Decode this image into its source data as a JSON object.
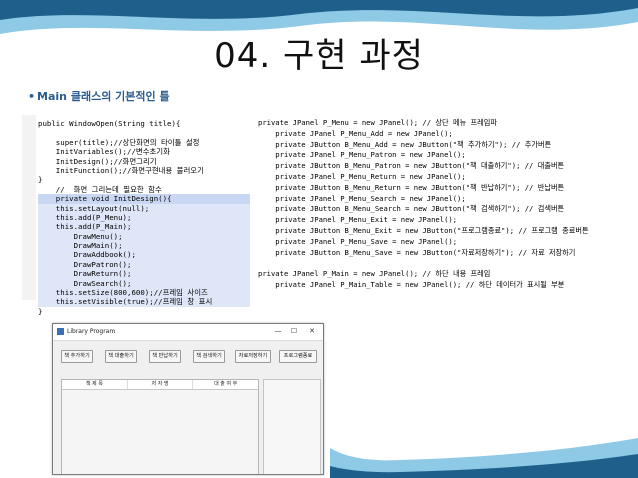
{
  "slide": {
    "title": "04. 구현 과정",
    "subtitle_bullet": "•",
    "subtitle": "Main 클래스의 기본적인 틀"
  },
  "code_left": [
    "public WindowOpen(String title){",
    "",
    "    super(title);//상단화면의 타이틀 설정",
    "    InitVariables();//변수초기화",
    "    InitDesign();//화면그리기",
    "    InitFunction();//화면구현내용 불러오기",
    "}",
    "    //  화면 그리는데 필요한 함수",
    "    private void InitDesign(){",
    "    this.setLayout(null);",
    "    this.add(P_Menu);",
    "    this.add(P_Main);",
    "        DrawMenu();",
    "        DrawMain();",
    "        DrawAddbook();",
    "        DrawPatron();",
    "        DrawReturn();",
    "        DrawSearch();",
    "    this.setSize(800,600);//프레임 사이즈",
    "    this.setVisible(true);//프레임 창 표시",
    "}"
  ],
  "code_right": [
    "private JPanel P_Menu = new JPanel(); // 상단 메뉴 프레임파",
    "    private JPanel P_Menu_Add = new JPanel();",
    "    private JButton B_Menu_Add = new JButton(\"책 추가하기\"); // 추가버튼",
    "    private JPanel P_Menu_Patron = new JPanel();",
    "    private JButton B_Menu_Patron = new JButton(\"책 대출하기\"); // 대출버튼",
    "    private JPanel P_Menu_Return = new JPanel();",
    "    private JButton B_Menu_Return = new JButton(\"책 반납하기\"); // 반납버튼",
    "    private JPanel P_Menu_Search = new JPanel();",
    "    private JButton B_Menu_Search = new JButton(\"책 검색하기\"); // 검색버튼",
    "    private JPanel P_Menu_Exit = new JPanel();",
    "    private JButton B_Menu_Exit = new JButton(\"프로그램종료\"); // 프로그램 종료버튼",
    "    private JPanel P_Menu_Save = new JPanel();",
    "    private JButton B_Menu_Save = new JButton(\"자료저장하기\"); // 자료 저장하기",
    "",
    "private JPanel P_Main = new JPanel(); // 하단 내용 프레임",
    "    private JPanel P_Main_Table = new JPanel(); // 하단 데이터가 표시될 부분"
  ],
  "window": {
    "title": "Library Program",
    "controls": [
      "—",
      "☐",
      "✕"
    ],
    "buttons": [
      "책 추가하기",
      "책 대출하기",
      "책 반납하기",
      "책 검색하기",
      "자료저장하기",
      "프로그램종료"
    ],
    "table_headers": [
      "책 제 목",
      "저 자 명",
      "대 출 여 부"
    ]
  },
  "colors": {
    "wave_dark": "#1f5f8b",
    "wave_light": "#8ec9e6",
    "subtitle": "#2c5d8e"
  }
}
